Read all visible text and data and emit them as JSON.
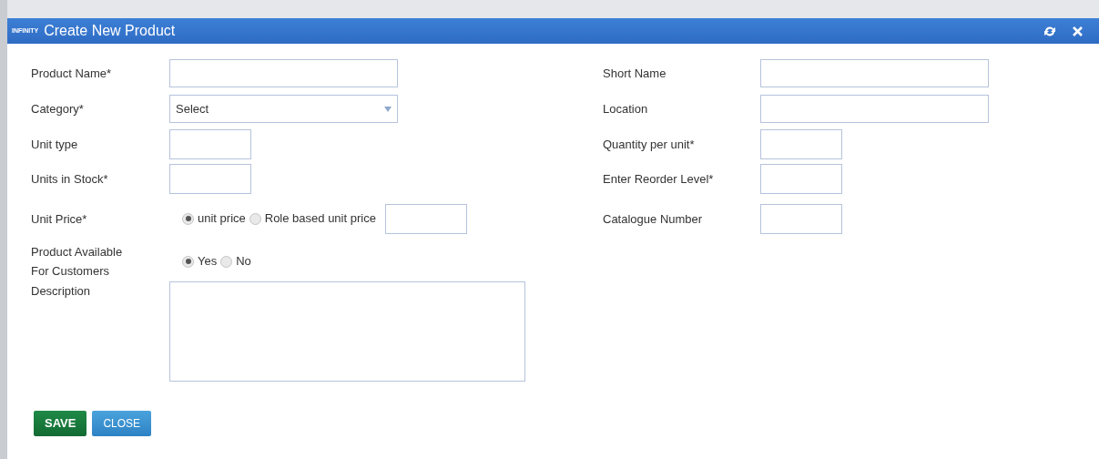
{
  "dialog": {
    "brand": "INFINITY",
    "title": "Create New Product"
  },
  "rows": [
    {
      "left": {
        "label": "Product Name*",
        "kind": "text"
      },
      "right": {
        "label": "Short Name",
        "kind": "text"
      }
    },
    {
      "left": {
        "label": "Category*",
        "kind": "select",
        "value": "Select"
      },
      "right": {
        "label": "Location",
        "kind": "text"
      }
    },
    {
      "left": {
        "label": "Unit type",
        "kind": "short"
      },
      "right": {
        "label": "Quantity per unit*",
        "kind": "short"
      }
    },
    {
      "left": {
        "label": "Units in Stock*",
        "kind": "short"
      },
      "right": {
        "label": "Enter Reorder Level*",
        "kind": "short"
      }
    },
    {
      "left": {
        "label": "Unit Price*",
        "kind": "radio",
        "options": [
          {
            "label": "unit price",
            "selected": true
          },
          {
            "label": "Role based unit price",
            "selected": false
          }
        ],
        "with_input": true
      },
      "right": {
        "label": "Catalogue Number",
        "kind": "short"
      }
    },
    {
      "left": {
        "label": "Product Available For Customers",
        "kind": "radio",
        "options": [
          {
            "label": "Yes",
            "selected": true
          },
          {
            "label": "No",
            "selected": false
          }
        ]
      }
    },
    {
      "left": {
        "label": "Description",
        "kind": "textarea"
      }
    }
  ],
  "buttons": [
    {
      "label": "SAVE",
      "kind": "primary"
    },
    {
      "label": "CLOSE",
      "kind": "secondary"
    }
  ]
}
